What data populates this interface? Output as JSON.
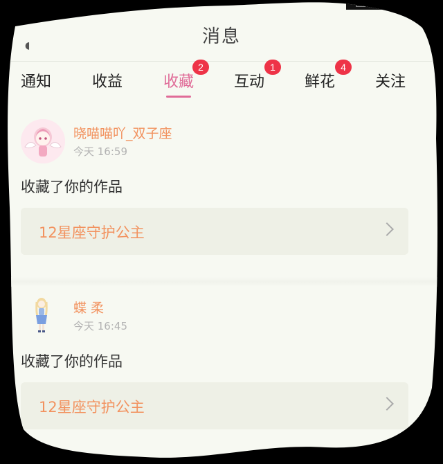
{
  "header": {
    "title": "消息"
  },
  "tabs": [
    {
      "label": "通知",
      "badge": null,
      "active": false
    },
    {
      "label": "收益",
      "badge": null,
      "active": false
    },
    {
      "label": "收藏",
      "badge": "2",
      "active": true
    },
    {
      "label": "互动",
      "badge": "1",
      "active": false
    },
    {
      "label": "鲜花",
      "badge": "4",
      "active": false
    },
    {
      "label": "关注",
      "badge": null,
      "active": false
    }
  ],
  "messages": [
    {
      "username": "晓喵喵吖_双子座",
      "time": "今天 16:59",
      "action": "收藏了你的作品",
      "work_title": "12星座守护公主",
      "avatar_icon": "anime-girl-winged-avatar"
    },
    {
      "username": "蝶 柔",
      "time": "今天 16:45",
      "action": "收藏了你的作品",
      "work_title": "12星座守护公主",
      "avatar_icon": "doll-avatar"
    }
  ],
  "colors": {
    "accent_pink": "#e06c98",
    "badge_red": "#ee3347",
    "name_orange": "#f2925f",
    "card_bg": "#eef0e6"
  }
}
